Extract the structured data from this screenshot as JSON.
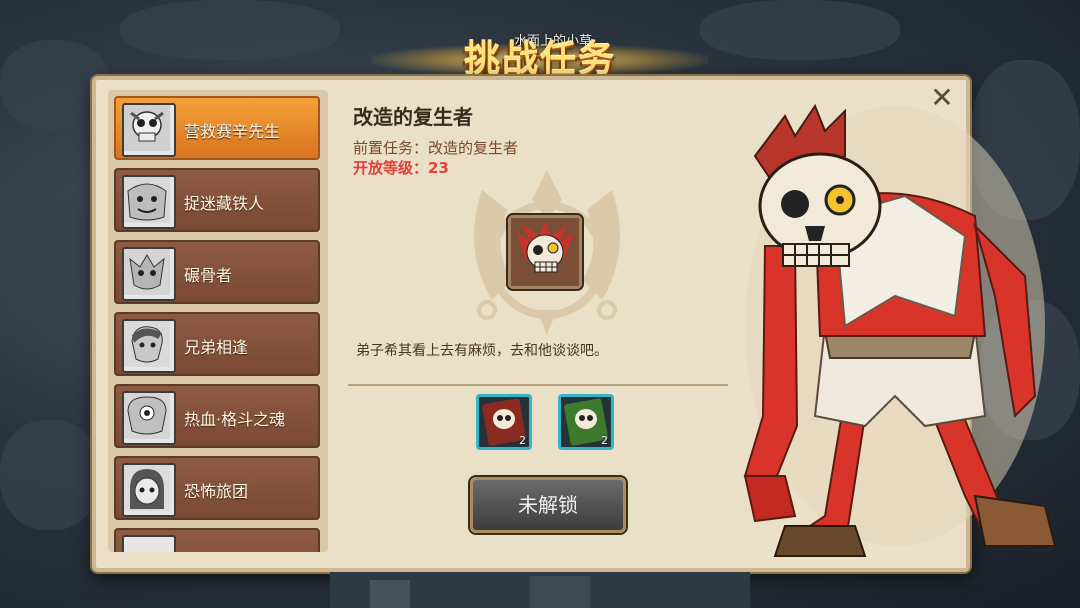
{
  "notices": [
    "水面上的小草"
  ],
  "header": {
    "title": "挑战任务"
  },
  "quest_list": [
    {
      "label": "营救赛辛先生",
      "active": true
    },
    {
      "label": "捉迷藏铁人",
      "active": false
    },
    {
      "label": "碾骨者",
      "active": false
    },
    {
      "label": "兄弟相逢",
      "active": false
    },
    {
      "label": "热血·格斗之魂",
      "active": false
    },
    {
      "label": "恐怖旅团",
      "active": false
    }
  ],
  "quest_detail": {
    "name": "改造的复生者",
    "prereq_label": "前置任务：",
    "prereq_value": "改造的复生者",
    "level_label": "开放等级：",
    "level_value": "23",
    "description": "弟子希其看上去有麻烦，去和他谈谈吧。"
  },
  "rewards": [
    {
      "icon": "skull-card-red",
      "count": "2",
      "border": "#35b4c8"
    },
    {
      "icon": "skull-card-green",
      "count": "2",
      "border": "#35b4c8"
    }
  ],
  "action": {
    "label": "未解锁"
  },
  "close": {
    "symbol": "✕"
  }
}
